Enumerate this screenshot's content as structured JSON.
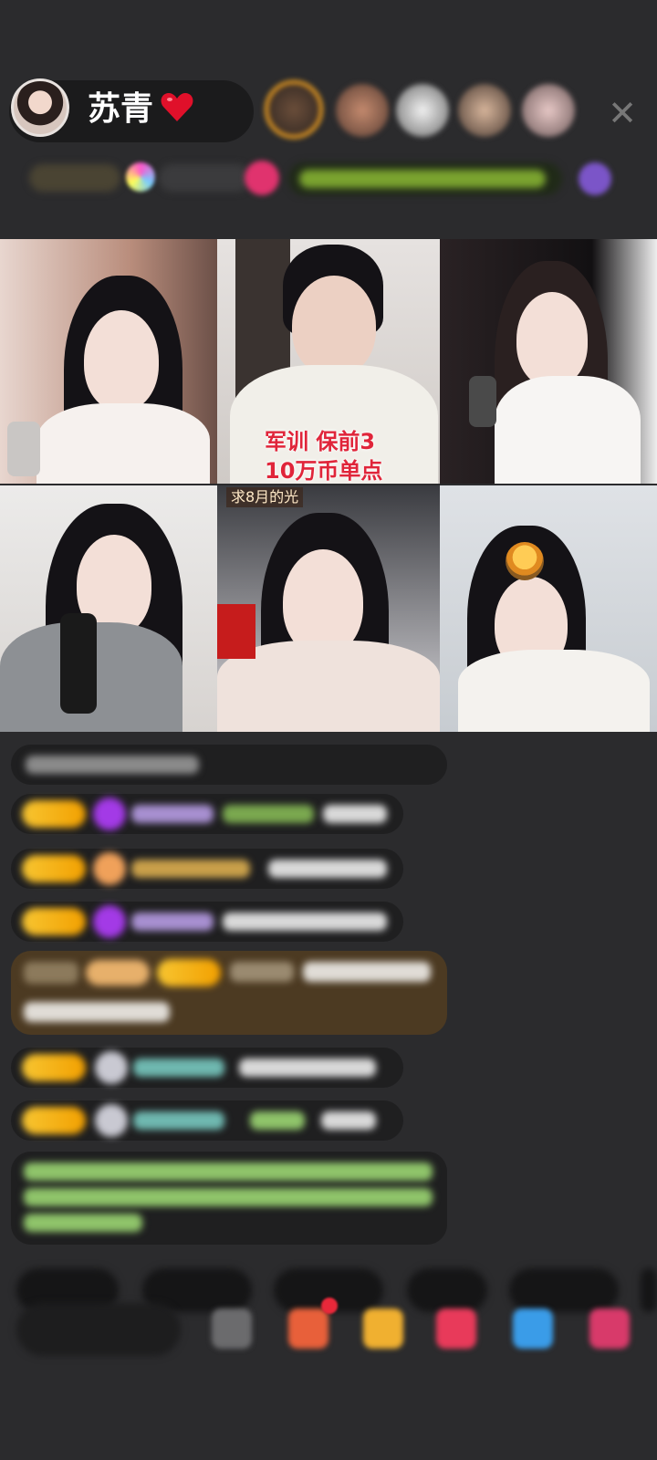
{
  "header": {
    "host_name": "苏青",
    "close_label": "✕"
  },
  "video_grid": {
    "overlay_text_line1": "军训 保前3",
    "overlay_text_line2": "10万币单点",
    "tag_label": "求8月的光"
  },
  "colors": {
    "background": "#2b2b2d",
    "overlay_text": "#e0253a",
    "level_badge": "#f7c531",
    "chat_green": "#9bd36a"
  },
  "icons": [
    "heart-icon",
    "close-icon",
    "avatar",
    "gift-icon",
    "emoji-icon"
  ]
}
